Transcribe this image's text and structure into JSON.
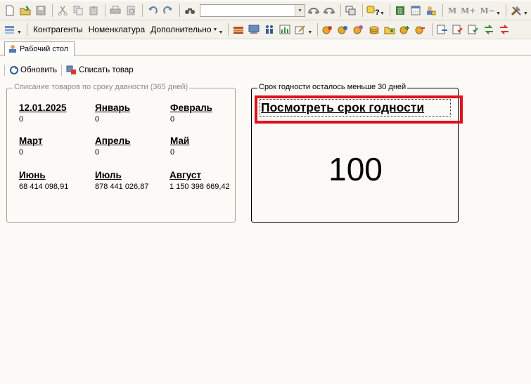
{
  "toolbar2": {
    "kontragenty": "Контрагенты",
    "nomenklatura": "Номенклатура",
    "dopolnitelno": "Дополнительно"
  },
  "toolbar1": {
    "m": "M",
    "mplus": "M+",
    "mminus": "M−"
  },
  "tab": {
    "label": "Рабочий стол"
  },
  "actions": {
    "refresh": "Обновить",
    "write_off": "Списать товар"
  },
  "writeoff_panel": {
    "title": "Списание товаров по сроку давности (365 дней)",
    "cells": [
      {
        "label": "12.01.2025",
        "value": "0"
      },
      {
        "label": "Январь",
        "value": "0"
      },
      {
        "label": "Февраль",
        "value": "0"
      },
      {
        "label": "Март",
        "value": "0"
      },
      {
        "label": "Апрель",
        "value": "0"
      },
      {
        "label": "Май",
        "value": "0"
      },
      {
        "label": "Июнь",
        "value": "68 414 098,91"
      },
      {
        "label": "Июль",
        "value": "878 441 026,87"
      },
      {
        "label": "Август",
        "value": "1 150 398 669,42"
      }
    ]
  },
  "expiry_panel": {
    "title": "Срок годности осталось меньше 30 дней",
    "link": "Посмотреть срок годности",
    "count": "100"
  },
  "colors": {
    "highlight": "#e3101d",
    "background": "#fbfaf6"
  }
}
